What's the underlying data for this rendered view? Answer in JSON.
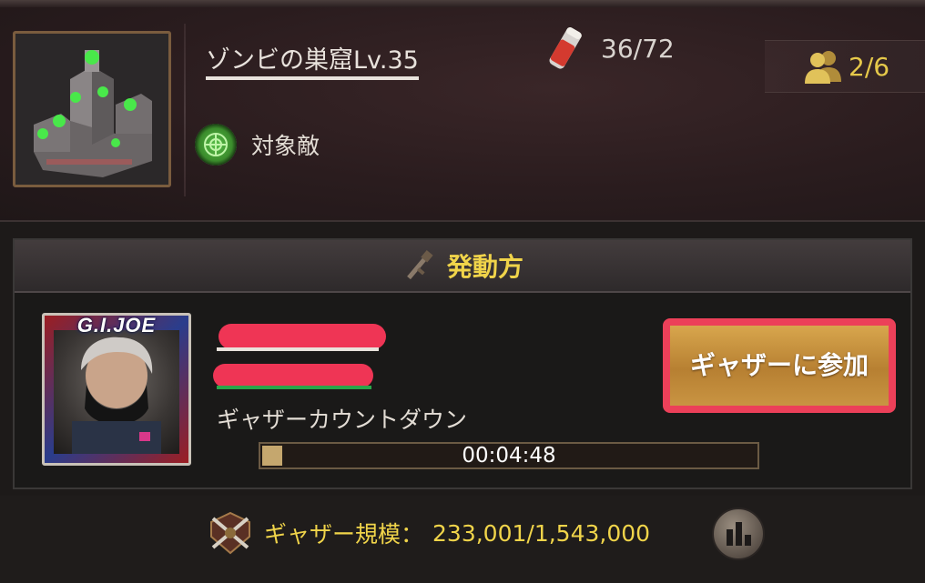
{
  "header": {
    "title": "ゾンビの巣窟Lv.35",
    "target_label": "対象敵",
    "ammo_count": "36/72",
    "members_count": "2/6",
    "thumbnail_icon": "zombie-lair-thumbnail",
    "target_icon": "radar-icon",
    "ammo_icon": "ammo-canister-icon",
    "members_icon": "members-icon"
  },
  "panel": {
    "title": "発動方",
    "title_icon": "rifle-icon",
    "avatar_brand": "G.I.JOE",
    "countdown_label": "ギャザーカウントダウン",
    "countdown_time": "00:04:48",
    "countdown_progress": 0.04,
    "join_button": "ギャザーに参加"
  },
  "footer": {
    "scale_label": "ギャザー規模：",
    "scale_value": "233,001/1,543,000",
    "scale_icon": "crossed-rifles-icon",
    "stats_icon": "bar-chart-icon"
  },
  "colors": {
    "accent_gold": "#f0d44a",
    "highlight_red": "#ec4059",
    "progress_fill": "#c5a76e"
  }
}
